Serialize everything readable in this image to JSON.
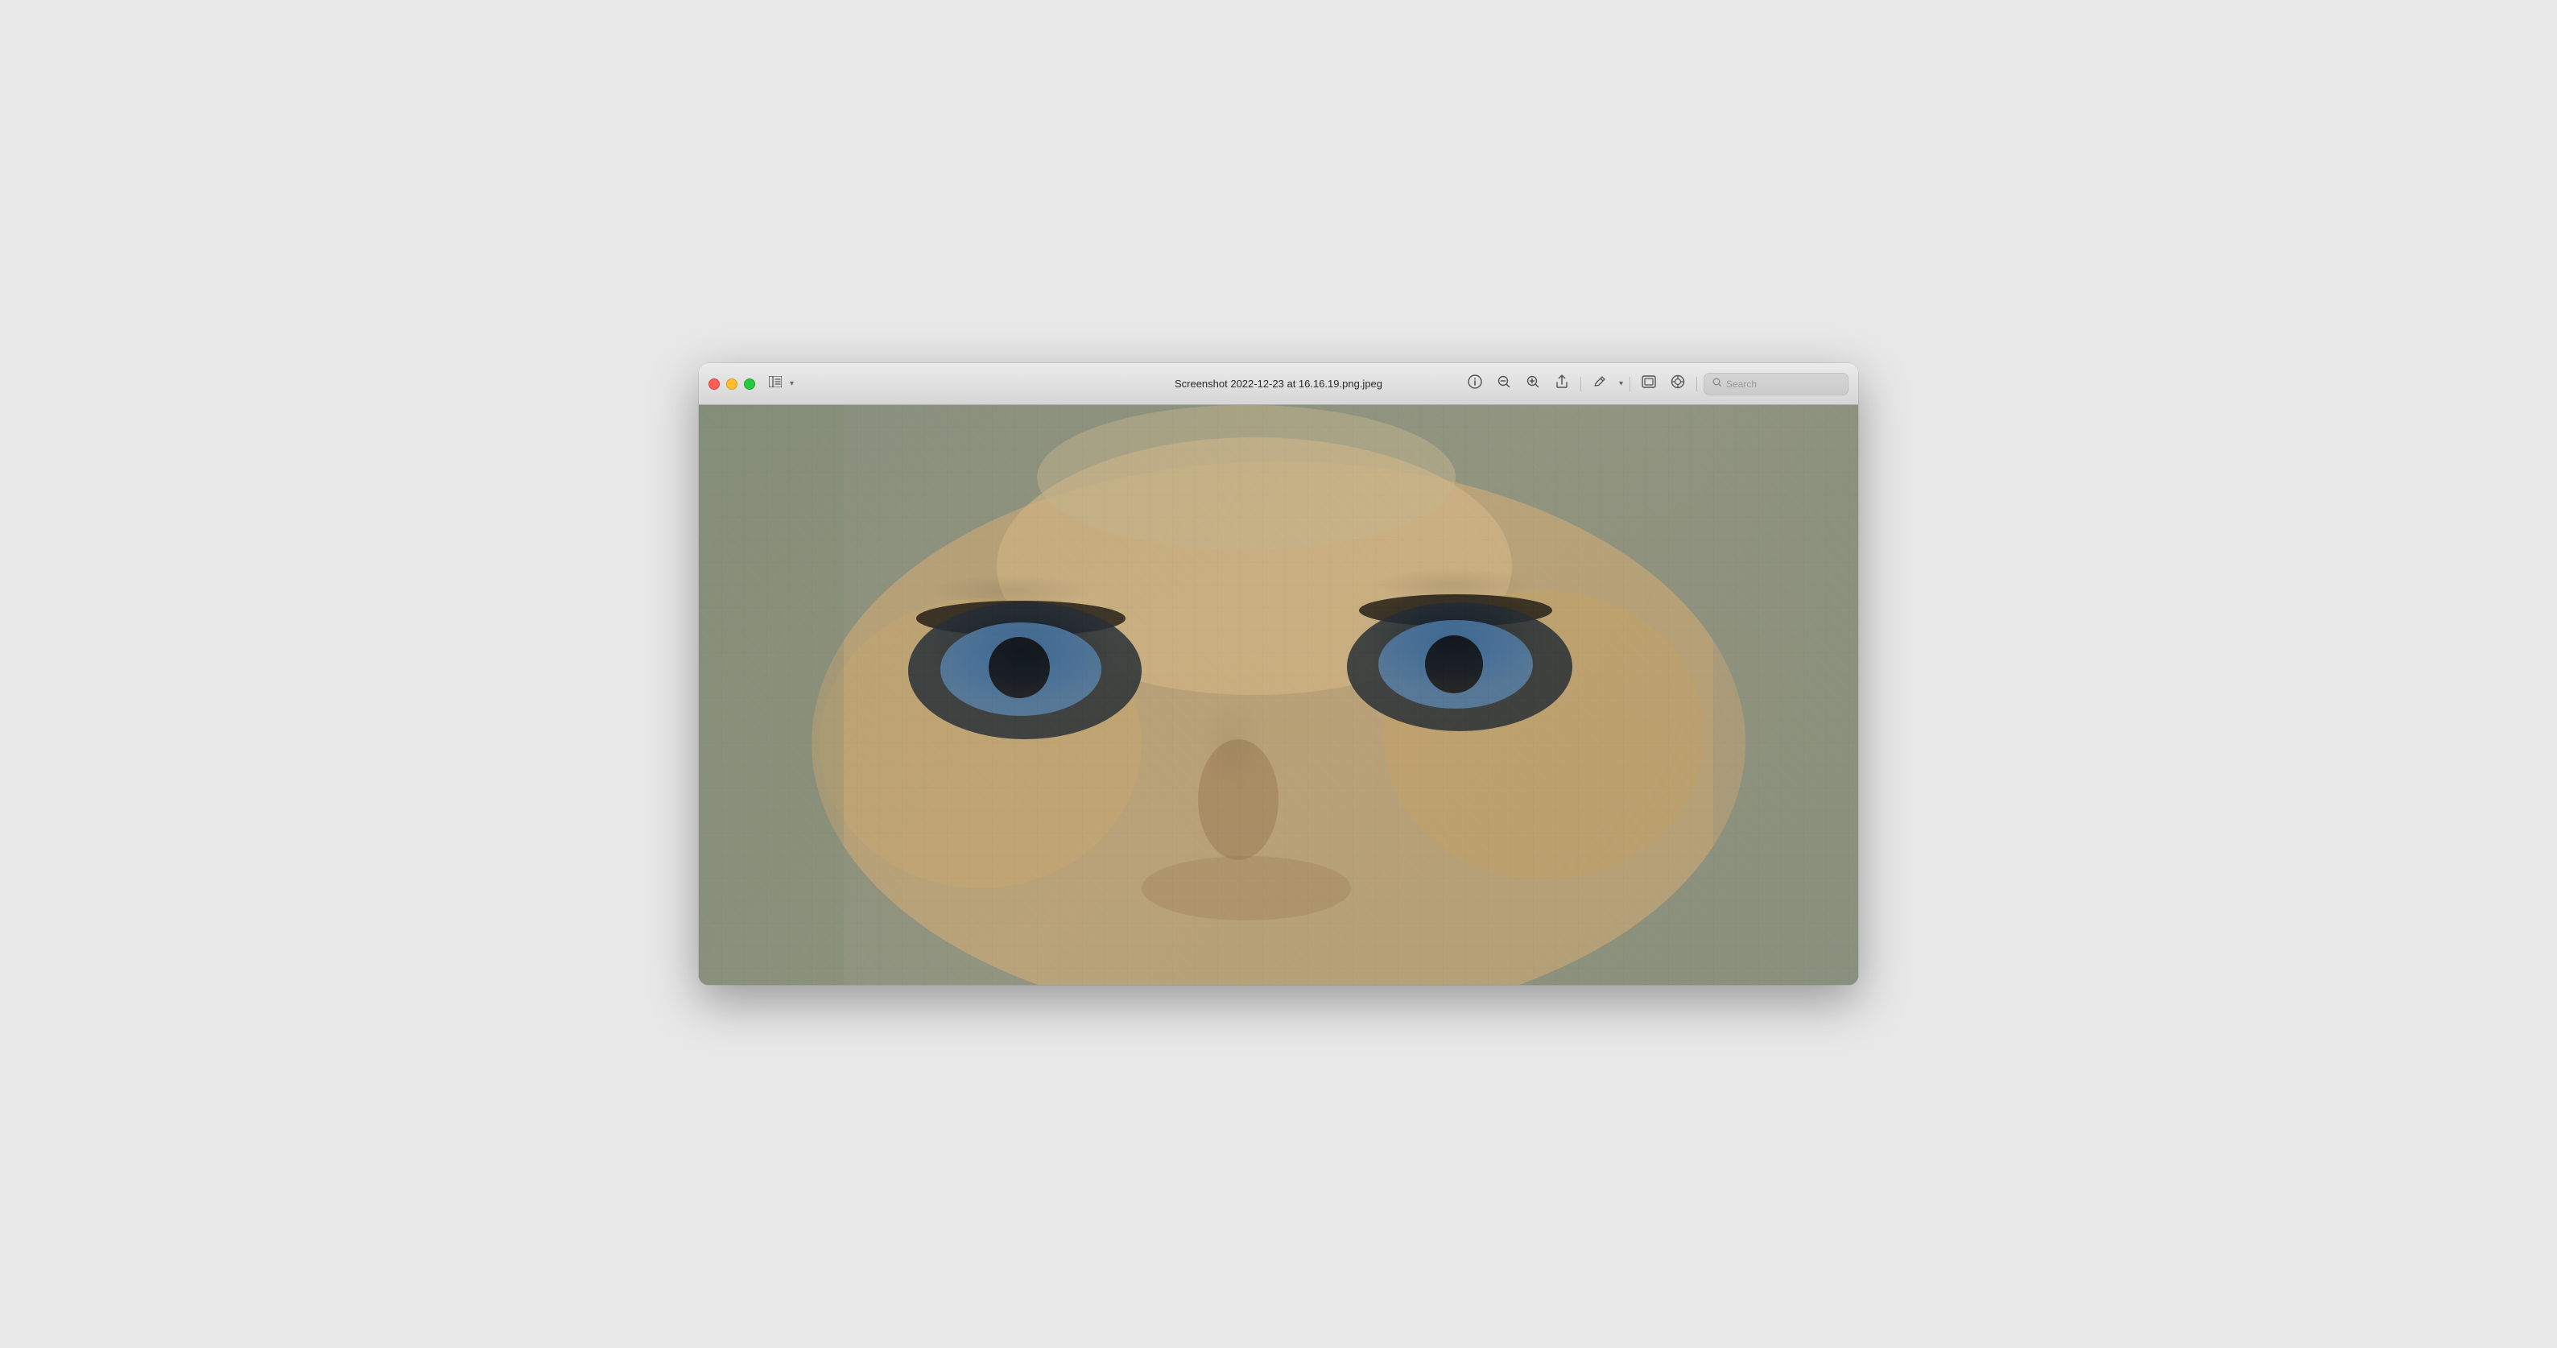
{
  "window": {
    "title": "Screenshot 2022-12-23 at 16.16.19.png.jpeg",
    "traffic_lights": {
      "close_label": "Close",
      "minimize_label": "Minimize",
      "maximize_label": "Maximize"
    }
  },
  "toolbar": {
    "sidebar_toggle_icon": "sidebar-icon",
    "chevron_label": "▾",
    "info_icon": "ℹ",
    "zoom_out_icon": "−",
    "zoom_in_icon": "+",
    "share_icon": "↑",
    "annotate_icon": "✏",
    "annotate_chevron": "▾",
    "window_icon": "⊡",
    "markup_icon": "◎",
    "search_placeholder": "Search"
  },
  "image": {
    "description": "Photo mosaic showing a face made of thousands of tiny photos",
    "filename": "Screenshot 2022-12-23 at 16.16.19.png.jpeg"
  }
}
